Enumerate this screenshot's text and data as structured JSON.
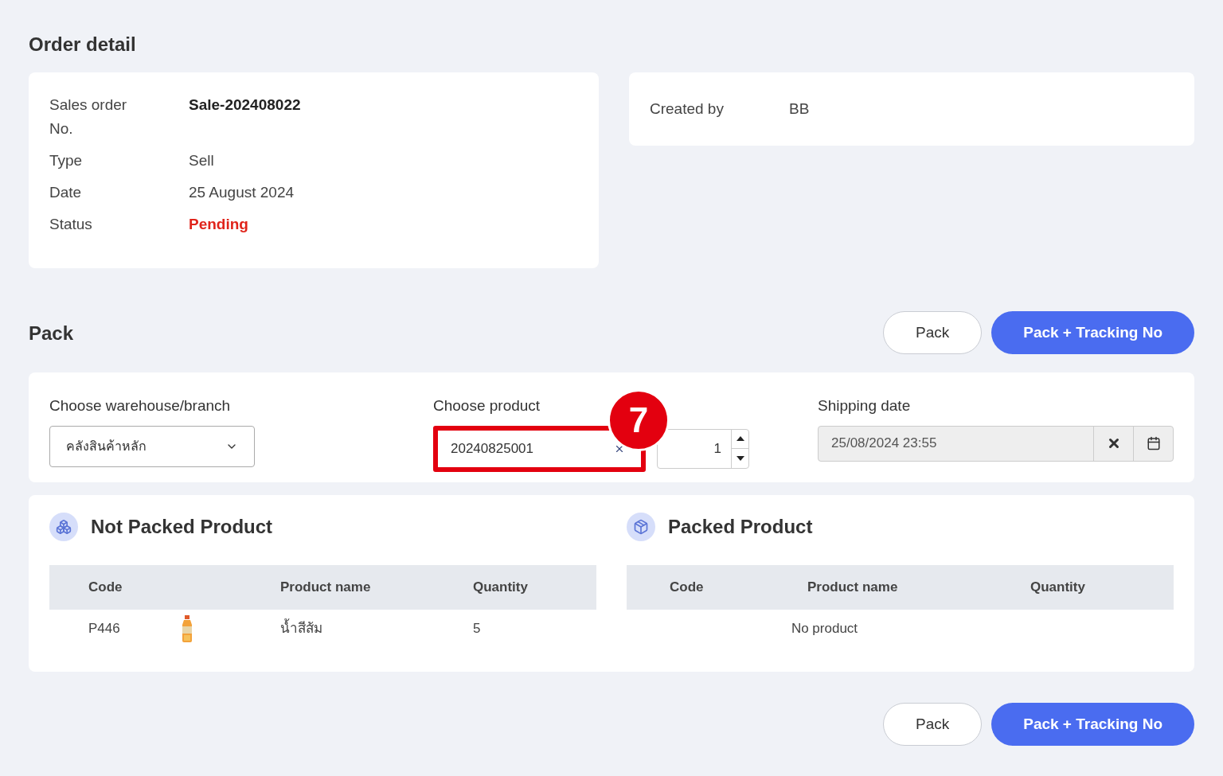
{
  "order_detail": {
    "title": "Order detail",
    "fields": [
      {
        "label": "Sales order No.",
        "value": "Sale-202408022",
        "kind": "bold"
      },
      {
        "label": "Type",
        "value": "Sell",
        "kind": "plain"
      },
      {
        "label": "Date",
        "value": "25 August 2024",
        "kind": "plain"
      },
      {
        "label": "Status",
        "value": "Pending",
        "kind": "status"
      }
    ],
    "created_by": {
      "label": "Created by",
      "value": "BB"
    }
  },
  "pack": {
    "title": "Pack",
    "top_buttons": [
      {
        "label": "Pack",
        "kind": "secondary"
      },
      {
        "label": "Pack + Tracking No",
        "kind": "primary"
      }
    ],
    "warehouse": {
      "label": "Choose warehouse/branch",
      "value": "คลังสินค้าหลัก"
    },
    "product": {
      "label": "Choose product",
      "value": "20240825001",
      "quantity": "1"
    },
    "shipping": {
      "label": "Shipping date",
      "value": "25/08/2024 23:55"
    },
    "callout": "7"
  },
  "not_packed": {
    "title": "Not Packed Product",
    "columns": [
      "Code",
      "Product name",
      "Quantity"
    ],
    "rows": [
      {
        "code": "P446",
        "name": "น้ำสีส้ม",
        "quantity": "5"
      }
    ]
  },
  "packed": {
    "title": "Packed Product",
    "columns": [
      "Code",
      "Product name",
      "Quantity"
    ],
    "empty": "No product"
  },
  "bottom_buttons": [
    {
      "label": "Pack",
      "kind": "secondary"
    },
    {
      "label": "Pack + Tracking No",
      "kind": "primary"
    }
  ]
}
